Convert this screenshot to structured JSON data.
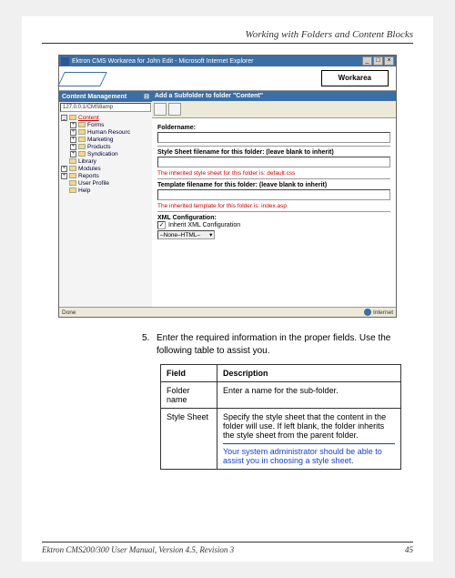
{
  "header": {
    "title": "Working with Folders and Content Blocks"
  },
  "browser": {
    "window_title": "Ektron CMS Workarea for John Edit - Microsoft Internet Explorer",
    "address": "127.0.0.1/CMS8amp",
    "workarea_label": "Workarea",
    "status_left": "Done",
    "status_right": "Internet"
  },
  "sidebar": {
    "header": "Content Management",
    "items": [
      {
        "label": "Content",
        "expand": "-",
        "selected": true,
        "sub": false
      },
      {
        "label": "Forms",
        "expand": "+",
        "selected": false,
        "sub": true
      },
      {
        "label": "Human Resourc",
        "expand": "+",
        "selected": false,
        "sub": true
      },
      {
        "label": "Marketing",
        "expand": "+",
        "selected": false,
        "sub": true
      },
      {
        "label": "Products",
        "expand": "+",
        "selected": false,
        "sub": true
      },
      {
        "label": "Syndication",
        "expand": "+",
        "selected": false,
        "sub": true
      },
      {
        "label": "Library",
        "expand": "",
        "selected": false,
        "sub": false
      },
      {
        "label": "Modules",
        "expand": "+",
        "selected": false,
        "sub": false
      },
      {
        "label": "Reports",
        "expand": "+",
        "selected": false,
        "sub": false
      },
      {
        "label": "User Profile",
        "expand": "",
        "selected": false,
        "sub": false
      },
      {
        "label": "Help",
        "expand": "",
        "selected": false,
        "sub": false
      }
    ]
  },
  "form": {
    "header": "Add a Subfolder to folder \"Content\"",
    "foldername_label": "Foldername:",
    "stylesheet_label": "Style Sheet filename for this folder: (leave blank to inherit)",
    "inherited_css": "The inherited style sheet for this folder is: default.css",
    "template_label": "Template filename for this folder: (leave blank to inherit)",
    "inherited_tpl": "The inherited template for this folder is: index.asp",
    "xml_label": "XML Configuration:",
    "inherit_xml_label": "Inherit XML Configuration",
    "select_value": "–None–HTML–"
  },
  "step": {
    "num": "5.",
    "text": "Enter the required information in the proper fields. Use the following table to assist you."
  },
  "table": {
    "col1": "Field",
    "col2": "Description",
    "rows": [
      {
        "field": "Folder name",
        "desc": "Enter a name for the sub-folder.",
        "note": ""
      },
      {
        "field": "Style Sheet",
        "desc": "Specify the style sheet that the content in the folder will use. If left blank, the folder inherits the style sheet from the parent folder.",
        "note": "Your system administrator should be able to assist you in choosing a style sheet."
      }
    ]
  },
  "footer": {
    "left": "Ektron CMS200/300 User Manual, Version 4.5, Revision 3",
    "right": "45"
  }
}
